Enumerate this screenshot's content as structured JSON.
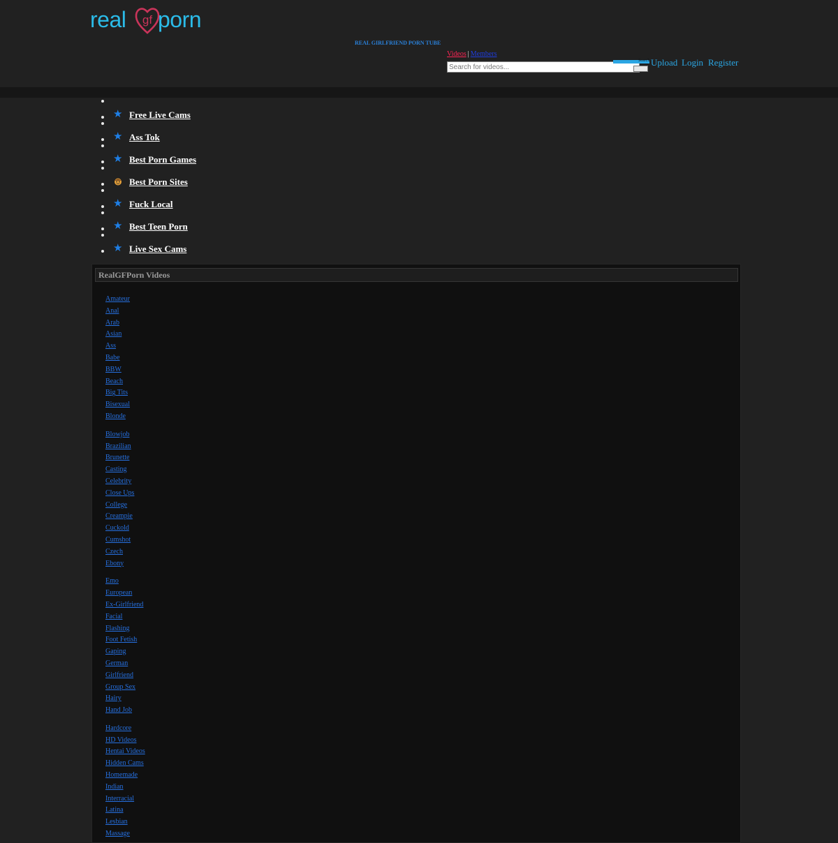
{
  "header": {
    "logo": {
      "text_left": "real",
      "text_heart": "gf",
      "text_right": "porn",
      "color": "#2bbbe8",
      "heart_color": "#c9345a"
    },
    "tagline": "REAL GIRLFRIEND PORN TUBE",
    "search": {
      "tabs": [
        {
          "label": "Videos",
          "active": true
        },
        {
          "label": "Members",
          "active": false
        }
      ],
      "separator": "|",
      "placeholder": "Search for videos...",
      "button_label": "Search"
    },
    "user_nav": {
      "upload": "Upload",
      "login": "Login",
      "register": "Register"
    }
  },
  "promo_links": [
    {
      "label": "Free Live Cams",
      "icon": "star-icon"
    },
    {
      "label": "Ass Tok",
      "icon": "star-icon"
    },
    {
      "label": "Best Porn Games",
      "icon": "star-icon"
    },
    {
      "label": "Best Porn Sites",
      "icon": "pornhub-face-icon"
    },
    {
      "label": "Fuck Local",
      "icon": "star-icon"
    },
    {
      "label": "Best Teen Porn",
      "icon": "star-icon"
    },
    {
      "label": "Live Sex Cams",
      "icon": "star-icon"
    }
  ],
  "categories_panel": {
    "title": "RealGFPorn Videos",
    "groups": [
      [
        "Amateur",
        "Anal",
        "Arab",
        "Asian",
        "Ass",
        "Babe",
        "BBW",
        "Beach",
        "Big Tits",
        "Bisexual",
        "Blonde"
      ],
      [
        "Blowjob",
        "Brazilian",
        "Brunette",
        "Casting",
        "Celebrity",
        "Close Ups",
        "College",
        "Creampie",
        "Cuckold",
        "Cumshot",
        "Czech",
        "Ebony"
      ],
      [
        "Emo",
        "European",
        "Ex-Girlfriend",
        "Facial",
        "Flashing",
        "Foot Fetish",
        "Gaping",
        "German",
        "Girlfriend",
        "Group Sex",
        "Hairy",
        "Hand Job"
      ],
      [
        "Hardcore",
        "HD Videos",
        "Hentai Videos",
        "Hidden Cams",
        "Homemade",
        "Indian",
        "Interracial",
        "Latina",
        "Lesbian",
        "Massage"
      ]
    ]
  },
  "colors": {
    "page_bg": "#212121",
    "panel_bg": "#101010",
    "accent": "#2ba6e3",
    "link": "#2670e0",
    "active_tab": "#ff2455"
  }
}
